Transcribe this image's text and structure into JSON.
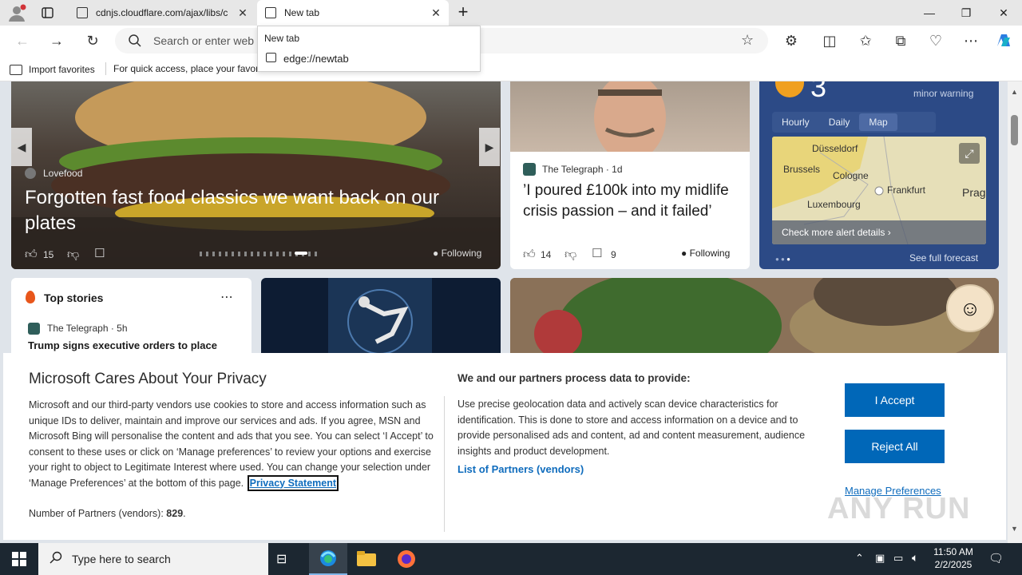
{
  "browser": {
    "tabs": [
      {
        "title": "cdnjs.cloudflare.com/ajax/libs/c",
        "active": false
      },
      {
        "title": "New tab",
        "active": true
      }
    ],
    "omnibox_placeholder": "Search or enter web",
    "dropdown": {
      "header": "New tab",
      "suggestion": "edge://newtab"
    },
    "favorites_bar": {
      "import_label": "Import favorites",
      "hint": "For quick access, place your favori"
    }
  },
  "feed": {
    "hero": {
      "source": "Lovefood",
      "headline": "Forgotten fast food classics we want back on our plates",
      "likes": "15",
      "following_label": "Following"
    },
    "story2": {
      "source": "The Telegraph · 1d",
      "headline": "’I poured £100k into my midlife crisis passion – and it failed’",
      "likes": "14",
      "comments": "9",
      "following_label": "Following"
    },
    "weather": {
      "temp": "3",
      "warning": "minor warning",
      "tabs": [
        "Hourly",
        "Daily",
        "Map"
      ],
      "cities": [
        "Düsseldorf",
        "Brussels",
        "Cologne",
        "Frankfurt",
        "Prag",
        "Luxembourg"
      ],
      "alert_link": "Check more alert details",
      "forecast_link": "See full forecast"
    },
    "top_stories": {
      "title": "Top stories",
      "source": "The Telegraph · 5h",
      "headline": "Trump signs executive orders to place"
    }
  },
  "consent": {
    "title": "Microsoft Cares About Your Privacy",
    "body": "Microsoft and our third-party vendors use cookies to store and access information such as unique IDs to deliver, maintain and improve our services and ads. If you agree, MSN and Microsoft Bing will personalise the content and ads that you see. You can select ‘I Accept’ to consent to these uses or click on ‘Manage preferences’ to review your options and exercise your right to object to Legitimate Interest where used.  You can change your selection under ‘Manage Preferences’ at the bottom of this page.",
    "privacy_link": "Privacy Statement",
    "partners_label": "Number of Partners (vendors):",
    "partners_count": "829",
    "partners_end": ".",
    "right_title": "We and our partners process data to provide:",
    "right_body": "Use precise geolocation data and actively scan device characteristics for identification. This is done to store and access information on a device and to provide personalised ads and content, ad and content measurement, audience insights and product development.",
    "list_link": "List of Partners (vendors)",
    "accept": "I Accept",
    "reject": "Reject All",
    "manage": "Manage Preferences"
  },
  "watermark": "ANY RUN",
  "taskbar": {
    "search_placeholder": "Type here to search",
    "time": "11:50 AM",
    "date": "2/2/2025"
  },
  "colors": {
    "accent": "#0067b8",
    "link": "#0f6cbd",
    "taskbar": "#1c2731",
    "weather_bg": "#2c4a86"
  }
}
